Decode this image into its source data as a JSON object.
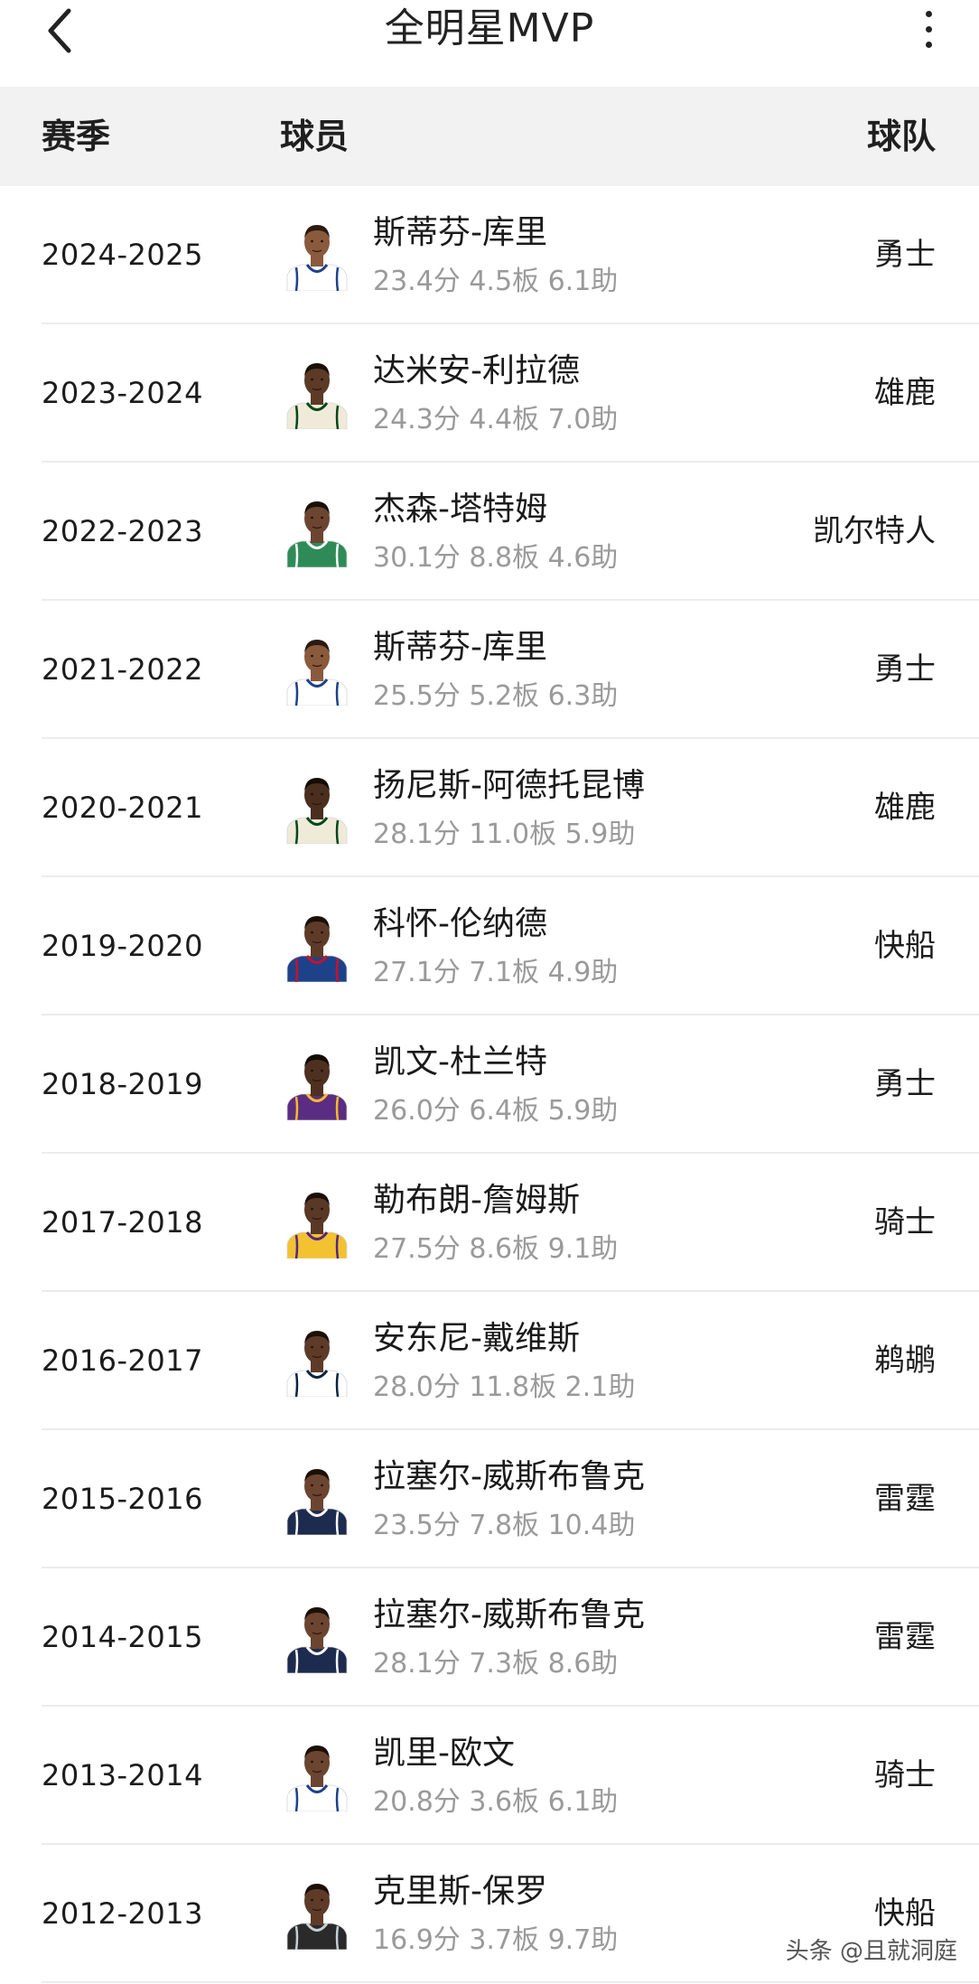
{
  "header": {
    "title": "全明星MVP",
    "back_icon": "chevron-left-icon",
    "more_icon": "more-vertical-icon"
  },
  "table": {
    "columns": {
      "season": "赛季",
      "player": "球员",
      "team": "球队"
    },
    "rows": [
      {
        "season": "2024-2025",
        "name": "斯蒂芬-库里",
        "stats": "23.4分 4.5板 6.1助",
        "team": "勇士",
        "jersey": "#ffffff",
        "trim": "#1d428a",
        "skin": "#8a5a3c",
        "hair": "#2a1a10"
      },
      {
        "season": "2023-2024",
        "name": "达米安-利拉德",
        "stats": "24.3分 4.4板 7.0助",
        "team": "雄鹿",
        "jersey": "#f0ebd8",
        "trim": "#00471b",
        "skin": "#5b3a26",
        "hair": "#1a1008"
      },
      {
        "season": "2022-2023",
        "name": "杰森-塔特姆",
        "stats": "30.1分 8.8板 4.6助",
        "team": "凯尔特人",
        "jersey": "#2e8b57",
        "trim": "#ffffff",
        "skin": "#6b4530",
        "hair": "#1a1008"
      },
      {
        "season": "2021-2022",
        "name": "斯蒂芬-库里",
        "stats": "25.5分 5.2板 6.3助",
        "team": "勇士",
        "jersey": "#ffffff",
        "trim": "#1d428a",
        "skin": "#8a5a3c",
        "hair": "#2a1a10"
      },
      {
        "season": "2020-2021",
        "name": "扬尼斯-阿德托昆博",
        "stats": "28.1分 11.0板 5.9助",
        "team": "雄鹿",
        "jersey": "#f0ebd8",
        "trim": "#00471b",
        "skin": "#4a2e1e",
        "hair": "#140c06"
      },
      {
        "season": "2019-2020",
        "name": "科怀-伦纳德",
        "stats": "27.1分 7.1板 4.9助",
        "team": "快船",
        "jersey": "#1d428a",
        "trim": "#c8102e",
        "skin": "#5e3b28",
        "hair": "#1a1008"
      },
      {
        "season": "2018-2019",
        "name": "凯文-杜兰特",
        "stats": "26.0分 6.4板 5.9助",
        "team": "勇士",
        "jersey": "#5a2d82",
        "trim": "#fdb927",
        "skin": "#4e3020",
        "hair": "#140c06"
      },
      {
        "season": "2017-2018",
        "name": "勒布朗-詹姆斯",
        "stats": "27.5分 8.6板 9.1助",
        "team": "骑士",
        "jersey": "#f2c230",
        "trim": "#552583",
        "skin": "#5a3826",
        "hair": "#1a1008"
      },
      {
        "season": "2016-2017",
        "name": "安东尼-戴维斯",
        "stats": "28.0分 11.8板 2.1助",
        "team": "鹈鹕",
        "jersey": "#ffffff",
        "trim": "#0c2340",
        "skin": "#5e3b28",
        "hair": "#1a1008"
      },
      {
        "season": "2015-2016",
        "name": "拉塞尔-威斯布鲁克",
        "stats": "23.5分 7.8板 10.4助",
        "team": "雷霆",
        "jersey": "#1d2b4f",
        "trim": "#ffffff",
        "skin": "#6b4530",
        "hair": "#1a1008"
      },
      {
        "season": "2014-2015",
        "name": "拉塞尔-威斯布鲁克",
        "stats": "28.1分 7.3板 8.6助",
        "team": "雷霆",
        "jersey": "#1d2b4f",
        "trim": "#ffffff",
        "skin": "#6b4530",
        "hair": "#1a1008"
      },
      {
        "season": "2013-2014",
        "name": "凯里-欧文",
        "stats": "20.8分 3.6板 6.1助",
        "team": "骑士",
        "jersey": "#ffffff",
        "trim": "#1d428a",
        "skin": "#6b4530",
        "hair": "#1a1008"
      },
      {
        "season": "2012-2013",
        "name": "克里斯-保罗",
        "stats": "16.9分 3.7板 9.7助",
        "team": "快船",
        "jersey": "#2a2a2a",
        "trim": "#c4ced4",
        "skin": "#5e3b28",
        "hair": "#1a1008"
      }
    ]
  },
  "watermark": "头条 @且就洞庭"
}
